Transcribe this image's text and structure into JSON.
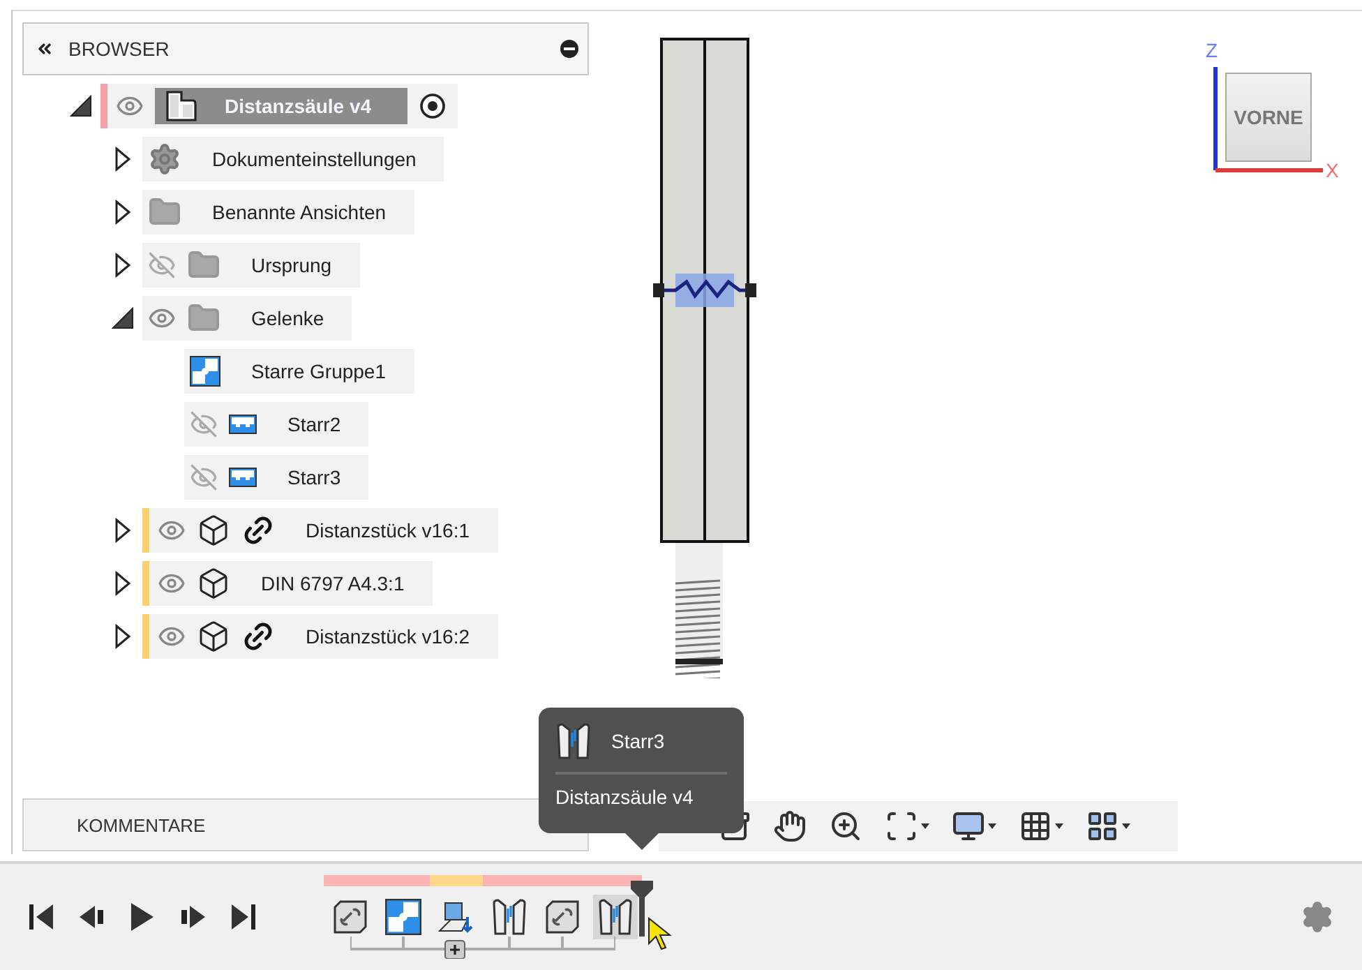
{
  "browser": {
    "title": "BROWSER",
    "tree": [
      {
        "label": "Distanzsäule v4",
        "kind": "root",
        "expanded": true,
        "visible": true,
        "active": true,
        "color": "#f4a0a8",
        "children": [
          {
            "label": "Dokumenteinstellungen",
            "kind": "settings",
            "expanded": false
          },
          {
            "label": "Benannte Ansichten",
            "kind": "folder",
            "expanded": false
          },
          {
            "label": "Ursprung",
            "kind": "folder",
            "expanded": false,
            "visible": false
          },
          {
            "label": "Gelenke",
            "kind": "folder",
            "expanded": true,
            "visible": true,
            "children": [
              {
                "label": "Starre Gruppe1",
                "kind": "rigid-group"
              },
              {
                "label": "Starr2",
                "kind": "joint",
                "visible": false
              },
              {
                "label": "Starr3",
                "kind": "joint",
                "visible": false
              }
            ]
          },
          {
            "label": "Distanzstück v16:1",
            "kind": "component",
            "expanded": false,
            "visible": true,
            "linked": true,
            "color": "#fcd06e"
          },
          {
            "label": "DIN 6797 A4.3:1",
            "kind": "component",
            "expanded": false,
            "visible": true,
            "linked": false,
            "color": "#fcd06e"
          },
          {
            "label": "Distanzstück v16:2",
            "kind": "component",
            "expanded": false,
            "visible": true,
            "linked": true,
            "color": "#fcd06e"
          }
        ]
      }
    ]
  },
  "comments": {
    "title": "KOMMENTARE"
  },
  "viewcube": {
    "face": "VORNE",
    "z_axis": "Z",
    "x_axis": "X"
  },
  "tooltip": {
    "title": "Starr3",
    "subtitle": "Distanzsäule v4"
  },
  "timeline": {
    "items": [
      {
        "kind": "linked-joint",
        "color": "#f9b3b3",
        "selected": false
      },
      {
        "kind": "rigid-group",
        "color": "#f9b3b3",
        "selected": false
      },
      {
        "kind": "move",
        "color": "#fdd88a",
        "selected": false
      },
      {
        "kind": "joint",
        "color": "#f9b3b3",
        "selected": false
      },
      {
        "kind": "linked-joint",
        "color": "#f9b3b3",
        "selected": false
      },
      {
        "kind": "joint",
        "color": "#f9b3b3",
        "selected": true
      }
    ]
  }
}
